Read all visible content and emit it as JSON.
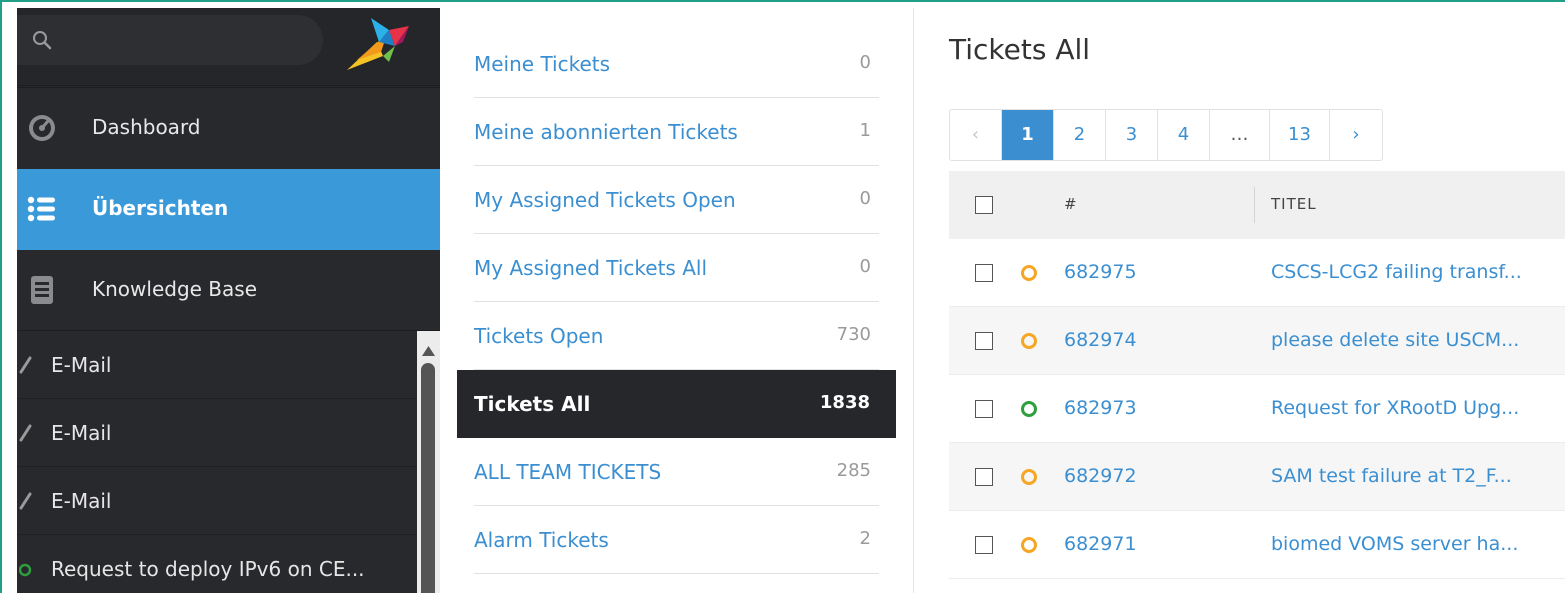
{
  "colors": {
    "accent": "#3b8fd1",
    "nav_bg": "#28292d",
    "nav_active": "#3a9ad9",
    "status_open": "#f5a623",
    "status_new": "#2e9e3e"
  },
  "nav": {
    "search": {
      "placeholder": "",
      "value": "",
      "icon": "search-icon"
    },
    "logo": "zammad-logo",
    "items": [
      {
        "label": "Dashboard",
        "icon": "dashboard-icon"
      },
      {
        "label": "Übersichten",
        "icon": "list-icon"
      },
      {
        "label": "Knowledge Base",
        "icon": "book-icon"
      }
    ],
    "tasks": [
      {
        "label": "E-Mail",
        "icon": "pencil-icon"
      },
      {
        "label": "E-Mail",
        "icon": "pencil-icon"
      },
      {
        "label": "E-Mail",
        "icon": "pencil-icon"
      },
      {
        "label": "Request to deploy IPv6 on CE...",
        "icon": "status-open-icon"
      }
    ]
  },
  "overviews": [
    {
      "label": "Meine Tickets",
      "count": "0"
    },
    {
      "label": "Meine abonnierten Tickets",
      "count": "1"
    },
    {
      "label": "My Assigned Tickets Open",
      "count": "0"
    },
    {
      "label": "My Assigned Tickets All",
      "count": "0"
    },
    {
      "label": "Tickets Open",
      "count": "730"
    },
    {
      "label": "Tickets All",
      "count": "1838"
    },
    {
      "label": "ALL TEAM TICKETS",
      "count": "285"
    },
    {
      "label": "Alarm Tickets",
      "count": "2"
    }
  ],
  "main": {
    "title": "Tickets All",
    "pagination": {
      "prev": "‹",
      "pages": [
        "1",
        "2",
        "3",
        "4",
        "…",
        "13"
      ],
      "current": "1",
      "next": "›"
    },
    "columns": {
      "number": "#",
      "title": "TITEL"
    },
    "rows": [
      {
        "number": "682975",
        "title": "CSCS-LCG2 failing transf...",
        "status": "open"
      },
      {
        "number": "682974",
        "title": "please delete site USCM...",
        "status": "open"
      },
      {
        "number": "682973",
        "title": "Request for XRootD Upg...",
        "status": "new"
      },
      {
        "number": "682972",
        "title": "SAM test failure at T2_F...",
        "status": "open"
      },
      {
        "number": "682971",
        "title": "biomed VOMS server ha...",
        "status": "open"
      }
    ]
  }
}
